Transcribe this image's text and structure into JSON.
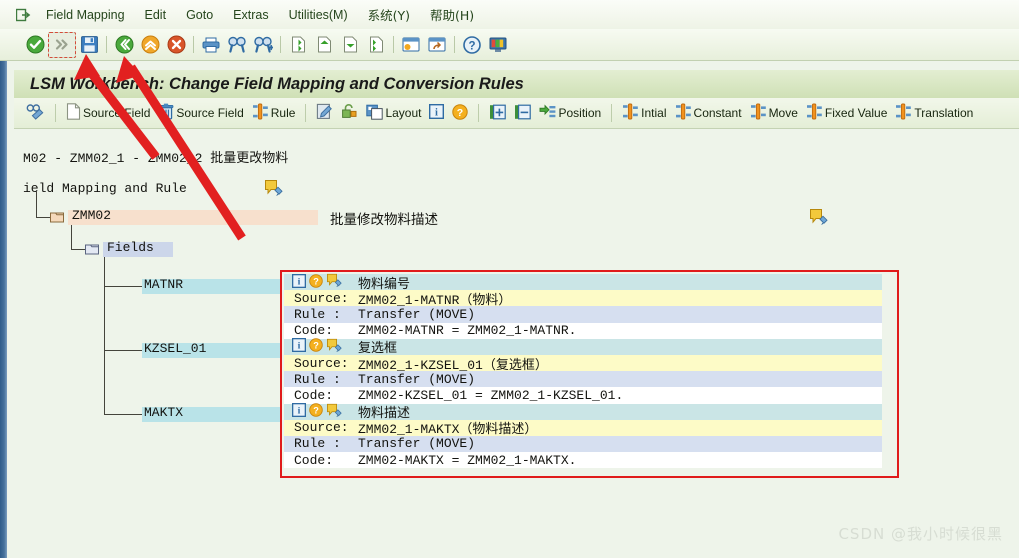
{
  "menu": {
    "exit_icon": "exit-icon",
    "items": [
      {
        "label": "Field Mapping",
        "accel": "F"
      },
      {
        "label": "Edit",
        "accel": "E"
      },
      {
        "label": "Goto",
        "accel": "G"
      },
      {
        "label": "Extras",
        "accel": "a"
      },
      {
        "label": "Utilities(M)",
        "accel": ""
      },
      {
        "label": "系统(Y)",
        "accel": ""
      },
      {
        "label": "帮助(H)",
        "accel": ""
      }
    ]
  },
  "toolbar": {
    "buttons": [
      {
        "name": "enter-check-icon",
        "selected": false
      },
      {
        "name": "command-more-icon",
        "selected": true
      },
      {
        "name": "save-icon",
        "selected": false
      },
      {
        "name": "back-icon",
        "selected": false
      },
      {
        "name": "exit-up-icon",
        "selected": false
      },
      {
        "name": "cancel-icon",
        "selected": false
      },
      {
        "name": "print-icon",
        "selected": false
      },
      {
        "name": "find-icon",
        "selected": false
      },
      {
        "name": "find-next-icon",
        "selected": false
      },
      {
        "name": "first-page-icon",
        "selected": false
      },
      {
        "name": "previous-page-icon",
        "selected": false
      },
      {
        "name": "next-page-icon",
        "selected": false
      },
      {
        "name": "last-page-icon",
        "selected": false
      },
      {
        "name": "create-session-icon",
        "selected": false
      },
      {
        "name": "create-shortcut-icon",
        "selected": false
      },
      {
        "name": "help-icon",
        "selected": false
      },
      {
        "name": "layout-menu-icon",
        "selected": false
      }
    ]
  },
  "title": {
    "text": "LSM Workbench: Change Field Mapping and Conversion Rules"
  },
  "apptoolbar": {
    "buttons": [
      {
        "name": "display-change-icon",
        "label": "",
        "icon": "glasses-pencil-icon"
      },
      {
        "name": "create-source-field",
        "label": "Source Field",
        "icon": "page-new-icon"
      },
      {
        "name": "delete-source-field",
        "label": "Source Field",
        "icon": "trash-icon"
      },
      {
        "name": "create-rule",
        "label": "Rule",
        "icon": "rule-icon"
      },
      {
        "name": "edit-button",
        "label": "",
        "icon": "edit-pencil-icon"
      },
      {
        "name": "lock-button",
        "label": "",
        "icon": "padlock-icon"
      },
      {
        "name": "layout-button",
        "label": "Layout",
        "icon": "layout-icon"
      },
      {
        "name": "info-button",
        "label": "",
        "icon": "info-icon"
      },
      {
        "name": "help-button",
        "label": "",
        "icon": "question-icon"
      },
      {
        "name": "expand-button",
        "label": "",
        "icon": "expand-node-icon"
      },
      {
        "name": "collapse-button",
        "label": "",
        "icon": "collapse-node-icon"
      },
      {
        "name": "position-button",
        "label": "Position",
        "icon": "position-icon"
      },
      {
        "name": "initial-button",
        "label": "Intial",
        "icon": "rule-icon"
      },
      {
        "name": "constant-button",
        "label": "Constant",
        "icon": "rule-icon"
      },
      {
        "name": "move-button",
        "label": "Move",
        "icon": "rule-icon"
      },
      {
        "name": "fixed-value-button",
        "label": "Fixed Value",
        "icon": "rule-icon"
      },
      {
        "name": "translation-button",
        "label": "Translation",
        "icon": "rule-icon"
      }
    ]
  },
  "content": {
    "object_header": "M02 - ZMM02_1 - ZMM02_2 批量更改物料",
    "section_header": "ield Mapping and Rule",
    "tree": {
      "structure_node": {
        "label": "ZMM02",
        "description": "批量修改物料描述"
      },
      "fields_node": {
        "label": "Fields"
      },
      "field_nodes": [
        {
          "label": "MATNR"
        },
        {
          "label": "KZSEL_01"
        },
        {
          "label": "MAKTX"
        }
      ]
    },
    "mappings": [
      {
        "title": "物料编号",
        "source_label": "Source:",
        "source_value": "ZMM02_1-MATNR（物料）",
        "rule_label": "Rule :",
        "rule_value": "Transfer (MOVE)",
        "code_label": "Code:",
        "code_value": "ZMM02-MATNR = ZMM02_1-MATNR."
      },
      {
        "title": "复选框",
        "source_label": "Source:",
        "source_value": "ZMM02_1-KZSEL_01（复选框）",
        "rule_label": "Rule :",
        "rule_value": "Transfer (MOVE)",
        "code_label": "Code:",
        "code_value": "ZMM02-KZSEL_01 = ZMM02_1-KZSEL_01."
      },
      {
        "title": "物料描述",
        "source_label": "Source:",
        "source_value": "ZMM02_1-MAKTX（物料描述）",
        "rule_label": "Rule :",
        "rule_value": "Transfer (MOVE)",
        "code_label": "Code:",
        "code_value": "ZMM02-MAKTX = ZMM02_1-MAKTX."
      }
    ],
    "row_icons": [
      "info-icon",
      "question-icon",
      "note-pencil-icon"
    ]
  },
  "annotations": {
    "highlight_box_color": "#e01b1b",
    "arrow_color": "#e22020",
    "arrow_count": 2
  },
  "watermark": {
    "text": "CSDN @我小时候很黑"
  }
}
